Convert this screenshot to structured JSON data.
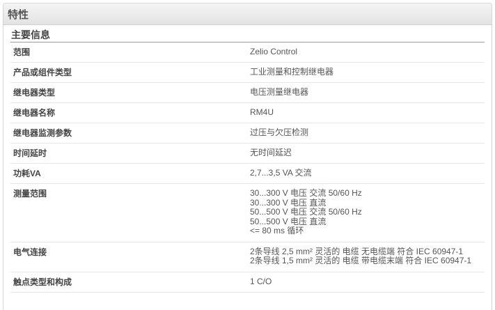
{
  "panel": {
    "title": "特性"
  },
  "section": {
    "title": "主要信息"
  },
  "rows": [
    {
      "label": "范围",
      "values": [
        "Zelio Control"
      ]
    },
    {
      "label": "产品或组件类型",
      "values": [
        "工业测量和控制继电器"
      ]
    },
    {
      "label": "继电器类型",
      "values": [
        "电压测量继电器"
      ]
    },
    {
      "label": "继电器名称",
      "values": [
        "RM4U"
      ]
    },
    {
      "label": "继电器监测参数",
      "values": [
        "过压与欠压检测"
      ]
    },
    {
      "label": "时间延时",
      "values": [
        "无时间延迟"
      ]
    },
    {
      "label": "功耗VA",
      "values": [
        "2,7...3,5 VA 交流"
      ]
    },
    {
      "label": "测量范围",
      "values": [
        "30...300 V 电压 交流 50/60 Hz",
        "30...300 V 电压 直流",
        "50...500 V 电压 交流 50/60 Hz",
        "50...500 V 电压 直流",
        "<= 80 ms 循环"
      ]
    },
    {
      "label": "电气连接",
      "values": [
        "2条导线 2,5 mm² 灵活的 电缆 无电缆端 符合 IEC 60947-1",
        "2条导线 1,5 mm² 灵活的 电缆 带电缆末端 符合 IEC 60947-1"
      ]
    },
    {
      "label": "触点类型和构成",
      "values": [
        "1 C/O"
      ]
    }
  ]
}
